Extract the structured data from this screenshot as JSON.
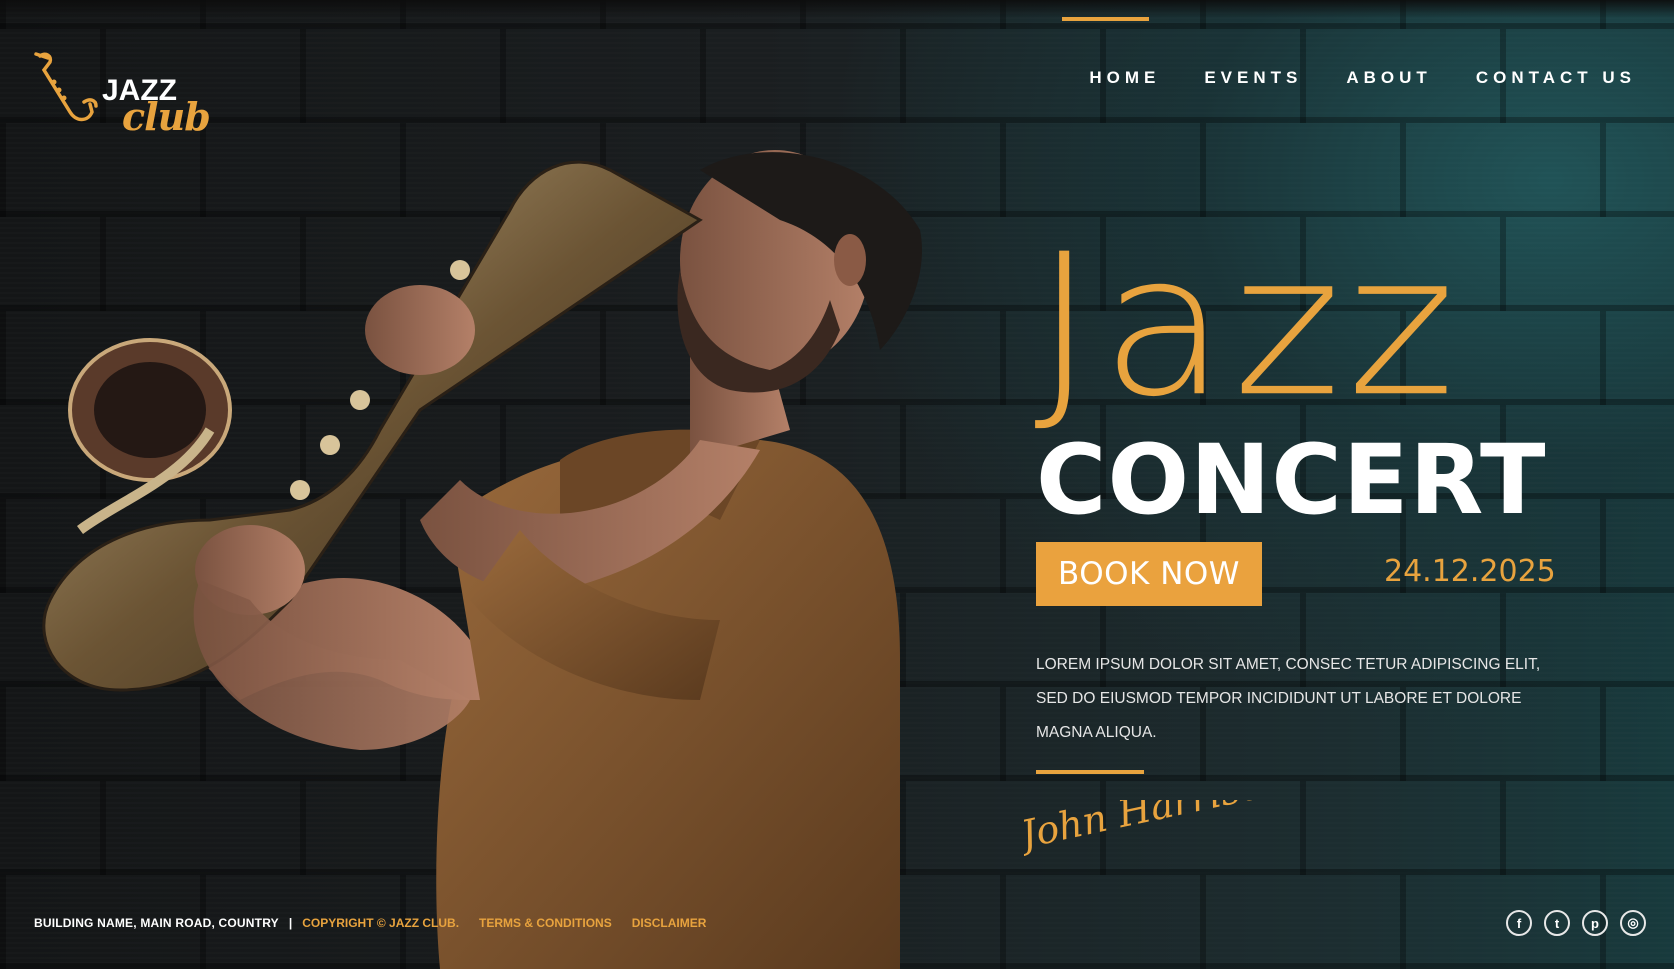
{
  "logo": {
    "line1": "JAZZ",
    "line2": "club",
    "icon": "saxophone-icon"
  },
  "nav": {
    "items": [
      {
        "label": "HOME",
        "active": true
      },
      {
        "label": "EVENTS"
      },
      {
        "label": "ABOUT"
      },
      {
        "label": "CONTACT US"
      }
    ]
  },
  "hero": {
    "script_title": "Jazz",
    "title": "CONCERT",
    "book_label": "BOOK NOW",
    "date": "24.12.2025",
    "description": "LOREM IPSUM DOLOR SIT AMET, CONSEC TETUR ADIPISCING ELIT, SED DO EIUSMOD TEMPOR INCIDIDUNT UT LABORE ET DOLORE MAGNA ALIQUA.",
    "signature": "John Harrison"
  },
  "footer": {
    "address": "BUILDING NAME, MAIN ROAD, COUNTRY",
    "separator": "|",
    "copyright": "COPYRIGHT © JAZZ CLUB.",
    "terms": "TERMS & CONDITIONS",
    "disclaimer": "DISCLAIMER"
  },
  "social": [
    {
      "icon": "facebook-icon",
      "glyph": "f"
    },
    {
      "icon": "twitter-icon",
      "glyph": "t"
    },
    {
      "icon": "pinterest-icon",
      "glyph": "p"
    },
    {
      "icon": "instagram-icon",
      "glyph": "◎"
    }
  ],
  "colors": {
    "accent": "#e8a33e",
    "text": "#ffffff",
    "background": "#1b1d1e",
    "teal_glow": "#215458"
  }
}
